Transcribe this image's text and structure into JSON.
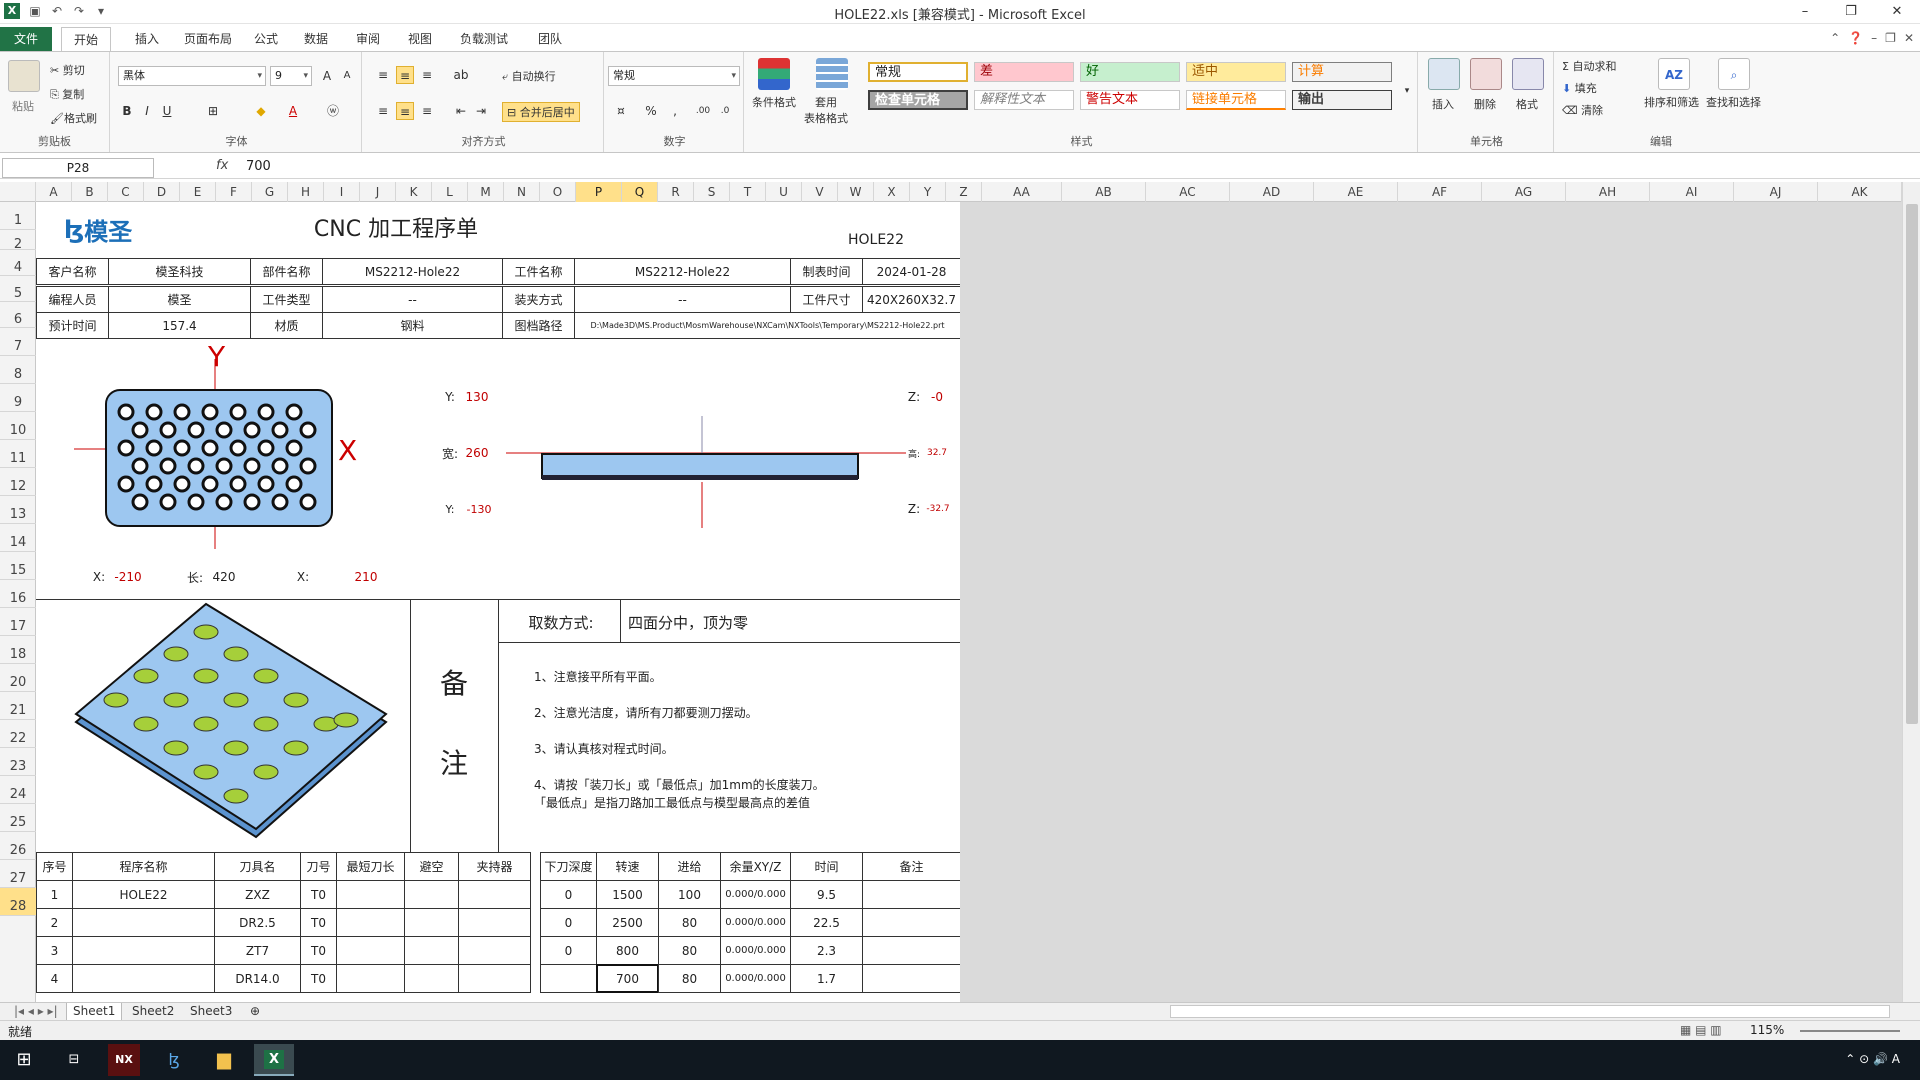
{
  "window": {
    "title": "HOLE22.xls  [兼容模式] - Microsoft Excel",
    "app_icon": "excel-icon",
    "controls": [
      "–",
      "❐",
      "✕"
    ]
  },
  "tabs": [
    "文件",
    "开始",
    "插入",
    "页面布局",
    "公式",
    "数据",
    "审阅",
    "视图",
    "负载测试",
    "团队"
  ],
  "ribbon": {
    "clipboard": {
      "label": "剪贴板",
      "paste": "粘贴",
      "cut": "剪切",
      "copy": "复制",
      "format_painter": "格式刷"
    },
    "font": {
      "label": "字体",
      "font_name": "黑体",
      "font_size": "9",
      "bold": "B",
      "italic": "I",
      "underline": "U"
    },
    "alignment": {
      "label": "对齐方式",
      "wrap": "自动换行",
      "merge": "合并后居中"
    },
    "number": {
      "label": "数字",
      "format": "常规",
      "percent": "%",
      "comma": ","
    },
    "styles": {
      "label": "样式",
      "conditional": "条件格式",
      "table_format": "套用\n表格格式",
      "cells": [
        "常规",
        "差",
        "好",
        "适中",
        "计算",
        "检查单元格",
        "解释性文本",
        "警告文本",
        "链接单元格",
        "输出"
      ]
    },
    "cells": {
      "label": "单元格",
      "insert": "插入",
      "delete": "删除",
      "format": "格式"
    },
    "editing": {
      "label": "编辑",
      "autosum": "自动求和",
      "fill": "填充",
      "clear": "清除",
      "sort": "排序和筛选",
      "find": "查找和选择"
    }
  },
  "formula_bar": {
    "name_box": "P28",
    "fx": "fx",
    "value": "700"
  },
  "columns": [
    "A",
    "B",
    "C",
    "D",
    "E",
    "F",
    "G",
    "H",
    "I",
    "J",
    "K",
    "L",
    "M",
    "N",
    "O",
    "P",
    "Q",
    "R",
    "S",
    "T",
    "U",
    "V",
    "W",
    "X",
    "Y",
    "Z",
    "AA",
    "AB",
    "AC",
    "AD",
    "AE",
    "AF",
    "AG",
    "AH",
    "AI",
    "AJ",
    "AK"
  ],
  "rows": [
    "1",
    "2",
    "4",
    "5",
    "6",
    "7",
    "8",
    "9",
    "10",
    "11",
    "12",
    "13",
    "14",
    "15",
    "16",
    "17",
    "18",
    "20",
    "21",
    "22",
    "23",
    "24",
    "25",
    "26",
    "27",
    "28"
  ],
  "selected": {
    "col1": "P",
    "col2": "Q",
    "row": "28"
  },
  "doc": {
    "logo": "模圣",
    "title": "CNC 加工程序单",
    "part_code": "HOLE22",
    "info": [
      [
        "客户名称",
        "模圣科技",
        "部件名称",
        "MS2212-Hole22",
        "工件名称",
        "MS2212-Hole22",
        "制表时间",
        "2024-01-28"
      ],
      [
        "编程人员",
        "模圣",
        "工件类型",
        "--",
        "装夹方式",
        "--",
        "工件尺寸",
        "420X260X32.7"
      ],
      [
        "预计时间",
        "157.4",
        "材质",
        "钢料",
        "图档路径",
        "D:\\Made3D\\MS.Product\\MosmWarehouse\\NXCam\\NXTools\\Temporary\\MS2212-Hole22.prt"
      ]
    ],
    "top_axis_y": "Y",
    "top_axis_x": "X",
    "bottom_dims": {
      "x_lbl1": "X:",
      "x_val1": "-210",
      "len_lbl": "长:",
      "len_val": "420",
      "x_lbl2": "X:",
      "x_val2": "210"
    },
    "side_dims": {
      "y_top_lbl": "Y:",
      "y_top": "130",
      "width_lbl": "宽:",
      "width": "260",
      "y_bot_lbl": "Y:",
      "y_bot": "-130",
      "z_top_lbl": "Z:",
      "z_top": "-0",
      "h_lbl": "高:",
      "h": "32.7",
      "z_bot_lbl": "Z:",
      "z_bot": "-32.7"
    },
    "remark_title_1": "备",
    "remark_title_2": "注",
    "fetch_label": "取数方式:",
    "fetch_value": "四面分中，顶为零",
    "notes": [
      "1、注意接平所有平面。",
      "2、注意光洁度，请所有刀都要测刀摆动。",
      "3、请认真核对程式时间。",
      "4、请按「装刀长」或「最低点」加1mm的长度装刀。",
      "「最低点」是指刀路加工最低点与模型最高点的差值"
    ],
    "table_headers": [
      "序号",
      "程序名称",
      "刀具名",
      "刀号",
      "最短刀长",
      "避空",
      "夹持器",
      "下刀深度",
      "转速",
      "进给",
      "余量XY/Z",
      "时间",
      "备注"
    ],
    "table_rows": [
      [
        "1",
        "HOLE22",
        "ZXZ",
        "T0",
        "",
        "",
        "",
        "0",
        "1500",
        "100",
        "0.000/0.000",
        "9.5",
        ""
      ],
      [
        "2",
        "",
        "DR2.5",
        "T0",
        "",
        "",
        "",
        "0",
        "2500",
        "80",
        "0.000/0.000",
        "22.5",
        ""
      ],
      [
        "3",
        "",
        "ZT7",
        "T0",
        "",
        "",
        "",
        "0",
        "800",
        "80",
        "0.000/0.000",
        "2.3",
        ""
      ],
      [
        "4",
        "",
        "DR14.0",
        "T0",
        "",
        "",
        "",
        "",
        "700",
        "80",
        "0.000/0.000",
        "1.7",
        ""
      ]
    ]
  },
  "sheets": [
    "Sheet1",
    "Sheet2",
    "Sheet3"
  ],
  "status": {
    "ready": "就绪",
    "zoom": "115%"
  },
  "taskbar": [
    "windows-start",
    "file-explorer",
    "nx",
    "mosm",
    "folder",
    "excel"
  ]
}
